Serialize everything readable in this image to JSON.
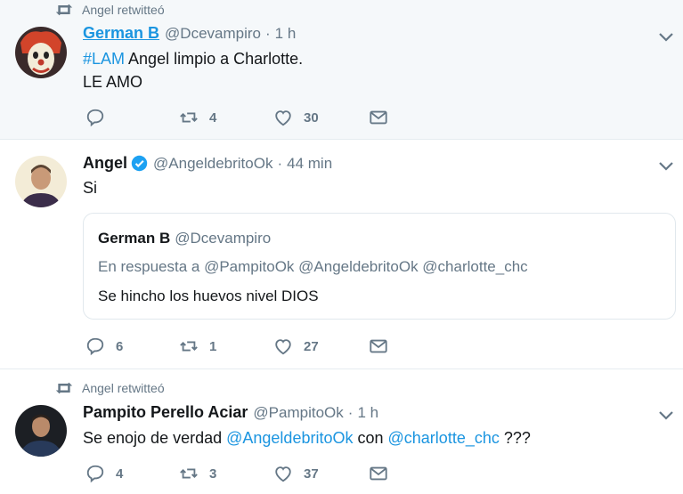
{
  "tweets": [
    {
      "retweet_label": "Angel retwitteó",
      "name": "German B",
      "handle": "@Dcevampiro",
      "time": "1 h",
      "hashtag": "#LAM",
      "text_rest": " Angel limpio a Charlotte.",
      "text_line2": "LE AMO",
      "retweets": "4",
      "likes": "30",
      "avatar_icon": "clown-avatar"
    },
    {
      "name": "Angel",
      "verified": true,
      "handle": "@AngeldebritoOk",
      "time": "44 min",
      "text": "Si",
      "quote": {
        "name": "German B",
        "handle": "@Dcevampiro",
        "reply_to": "En respuesta a @PampitoOk @AngeldebritoOk @charlotte_chc",
        "text": "Se hincho los huevos nivel DIOS"
      },
      "replies": "6",
      "retweets": "1",
      "likes": "27"
    },
    {
      "retweet_label": "Angel retwitteó",
      "name": "Pampito Perello Aciar",
      "handle": "@PampitoOk",
      "time": "1 h",
      "text_a": "Se enojo de verdad ",
      "mention_1": "@AngeldebritoOk",
      "text_b": " con ",
      "mention_2": "@charlotte_chc",
      "text_c": " ???",
      "replies": "4",
      "retweets": "3",
      "likes": "37"
    }
  ],
  "colors": {
    "link": "#1b95e0",
    "muted": "#657786",
    "highlight_bg": "#f5f8fa"
  },
  "dot": "·"
}
